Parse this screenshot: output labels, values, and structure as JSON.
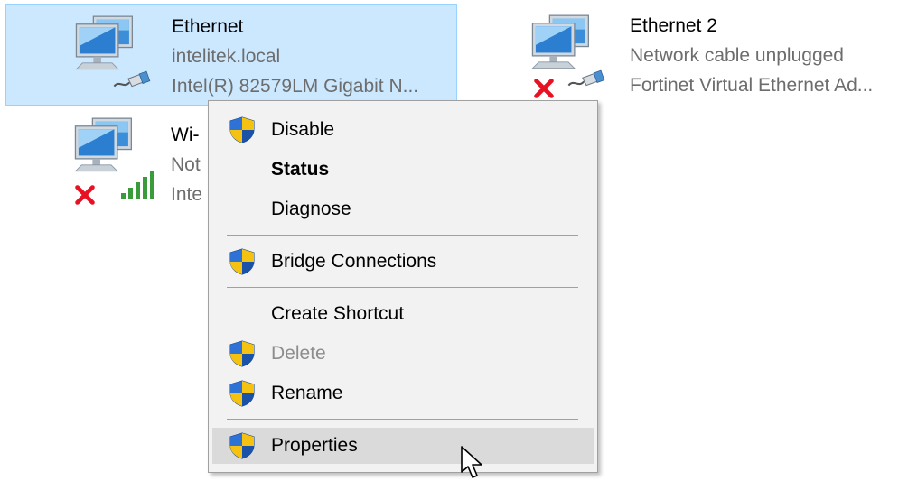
{
  "adapters": [
    {
      "name": "Ethernet",
      "line1": "intelitek.local",
      "line2": "Intel(R) 82579LM Gigabit N...",
      "selected": true,
      "status_icon": "network-cable-icon"
    },
    {
      "name": "Ethernet 2",
      "line1": "Network cable unplugged",
      "line2": "Fortinet Virtual Ethernet Ad...",
      "selected": false,
      "status_icon": "error-x-icon"
    },
    {
      "name": "Wi-",
      "line1": "Not",
      "line2": "Inte",
      "selected": false,
      "status_icon": "wifi-signal-bars-icon"
    }
  ],
  "context_menu": {
    "items": [
      {
        "label": "Disable",
        "icon": "uac-shield-icon",
        "bold": false,
        "disabled": false
      },
      {
        "label": "Status",
        "icon": null,
        "bold": true,
        "disabled": false
      },
      {
        "label": "Diagnose",
        "icon": null,
        "bold": false,
        "disabled": false
      },
      {
        "label": "Bridge Connections",
        "icon": "uac-shield-icon",
        "bold": false,
        "disabled": false
      },
      {
        "label": "Create Shortcut",
        "icon": null,
        "bold": false,
        "disabled": false
      },
      {
        "label": "Delete",
        "icon": "uac-shield-icon",
        "bold": false,
        "disabled": true
      },
      {
        "label": "Rename",
        "icon": "uac-shield-icon",
        "bold": false,
        "disabled": false
      },
      {
        "label": "Properties",
        "icon": "uac-shield-icon",
        "bold": false,
        "disabled": false,
        "hovered": true
      }
    ]
  },
  "colors": {
    "selection_bg": "#cce8ff",
    "selection_border": "#99d1ff",
    "menu_bg": "#f2f2f2",
    "menu_hover": "#dadada",
    "secondary_text": "#6d6d6d",
    "disabled_text": "#8d8d8d",
    "shield_blue": "#1f5fc4",
    "shield_yellow": "#f5c211",
    "error_red": "#e81123",
    "signal_green": "#3a9b3a"
  }
}
